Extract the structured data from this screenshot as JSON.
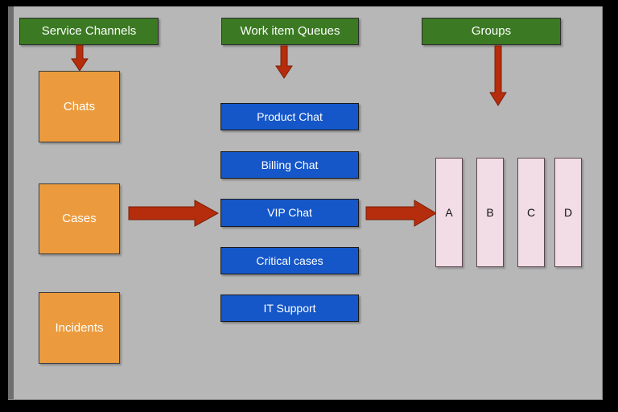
{
  "diagram": {
    "title": "Service Channels to Work Item Queues to Groups routing diagram",
    "canvas_color": "#b7b7b7",
    "colors": {
      "header_green": "#3b7a23",
      "channel_orange": "#eb9b3e",
      "queue_blue": "#1557c8",
      "group_pink": "#f2dde6",
      "arrow_red": "#b52d0c"
    }
  },
  "columns": {
    "service_channels": {
      "header": "Service Channels",
      "items": [
        {
          "label": "Chats"
        },
        {
          "label": "Cases"
        },
        {
          "label": "Incidents"
        }
      ]
    },
    "work_item_queues": {
      "header": "Work item Queues",
      "items": [
        {
          "label": "Product Chat"
        },
        {
          "label": "Billing Chat"
        },
        {
          "label": "VIP Chat"
        },
        {
          "label": "Critical cases"
        },
        {
          "label": "IT Support"
        }
      ]
    },
    "groups": {
      "header": "Groups",
      "items": [
        {
          "label": "A"
        },
        {
          "label": "B"
        },
        {
          "label": "C"
        },
        {
          "label": "D"
        }
      ]
    }
  },
  "arrows": [
    {
      "name": "service-channels-to-chats",
      "direction": "down"
    },
    {
      "name": "work-item-queues-to-product-chat",
      "direction": "down"
    },
    {
      "name": "groups-to-group-boxes",
      "direction": "down"
    },
    {
      "name": "cases-to-vip-chat",
      "direction": "right"
    },
    {
      "name": "vip-chat-to-group-a",
      "direction": "right"
    }
  ]
}
